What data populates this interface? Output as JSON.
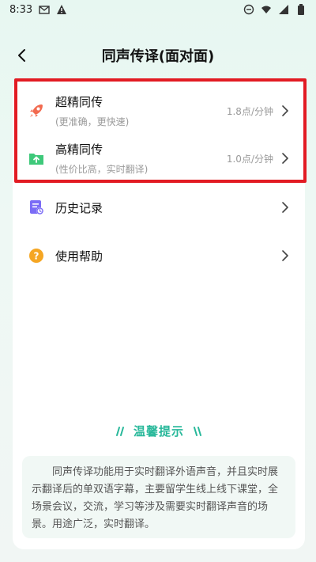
{
  "status_bar": {
    "time": "8:33",
    "icons_left": [
      "gmail-icon",
      "warning-icon"
    ],
    "icons_right": [
      "do-not-disturb-icon",
      "wifi-icon",
      "signal-icon",
      "battery-icon"
    ]
  },
  "header": {
    "title": "同声传译(面对面)"
  },
  "menu": {
    "items": [
      {
        "title": "超精同传",
        "subtitle": "(更准确，更快速)",
        "price": "1.8点/分钟",
        "icon": "rocket-icon"
      },
      {
        "title": "高精同传",
        "subtitle": "(性价比高，实时翻译)",
        "price": "1.0点/分钟",
        "icon": "folder-upload-icon"
      },
      {
        "title": "历史记录",
        "icon": "history-icon"
      },
      {
        "title": "使用帮助",
        "icon": "help-icon"
      }
    ]
  },
  "tips": {
    "title": "温馨提示",
    "text": "同声传译功能用于实时翻译外语声音，并且实时展示翻译后的单双语字幕，主要留学生线上线下课堂，全场景会议，交流，学习等涉及需要实时翻译声音的场景。用途广泛，实时翻译。"
  },
  "colors": {
    "accent": "#28b89a",
    "highlight": "#e21b23",
    "rocket": "#f26a4f",
    "folder": "#3ec97a",
    "history": "#7b6cf6",
    "help": "#f5a623"
  }
}
